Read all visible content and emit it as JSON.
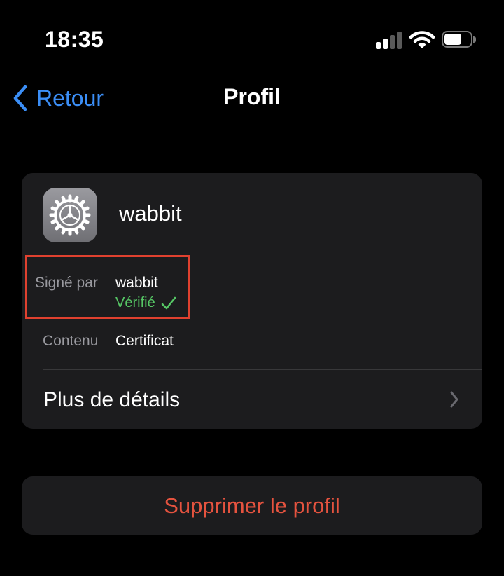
{
  "status_bar": {
    "time": "18:35"
  },
  "nav": {
    "back_label": "Retour",
    "title": "Profil"
  },
  "profile": {
    "name": "wabbit",
    "signed_by_label": "Signé par",
    "signed_by_value": "wabbit",
    "verified_label": "Vérifié",
    "content_label": "Contenu",
    "content_value": "Certificat",
    "more_details_label": "Plus de détails"
  },
  "actions": {
    "delete_label": "Supprimer le profil"
  },
  "colors": {
    "accent": "#3b8ef6",
    "verified": "#56c765",
    "destructive": "#e5533f",
    "highlight": "#e0412f"
  },
  "icons": [
    "back-chevron-icon",
    "settings-gear-icon",
    "checkmark-icon",
    "chevron-right-icon",
    "cellular-signal-icon",
    "wifi-icon",
    "battery-icon"
  ]
}
